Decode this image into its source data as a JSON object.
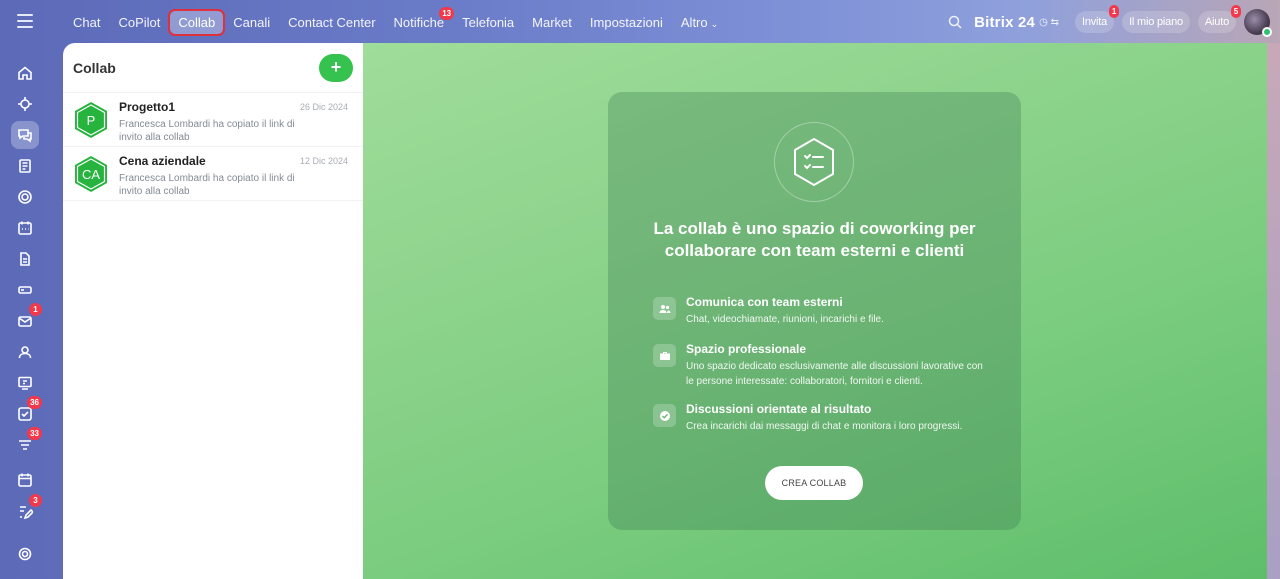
{
  "topnav": {
    "items": [
      {
        "label": "Chat"
      },
      {
        "label": "CoPilot"
      },
      {
        "label": "Collab",
        "active": true
      },
      {
        "label": "Canali"
      },
      {
        "label": "Contact Center"
      },
      {
        "label": "Notifiche",
        "badge": "13"
      },
      {
        "label": "Telefonia"
      },
      {
        "label": "Market"
      },
      {
        "label": "Impostazioni"
      },
      {
        "label": "Altro"
      }
    ],
    "brand": "Bitrix 24",
    "invite_label": "Invita",
    "invite_badge": "1",
    "plan_label": "Il mio piano",
    "help_label": "Aiuto",
    "help_badge": "5"
  },
  "rail": {
    "badges": {
      "mail": "1",
      "tasks": "36",
      "feed": "33",
      "edit": "3"
    }
  },
  "panel": {
    "title": "Collab",
    "items": [
      {
        "initials": "P",
        "name": "Progetto1",
        "date": "26 Dic 2024",
        "message": "Francesca Lombardi ha copiato il link di invito alla collab"
      },
      {
        "initials": "CA",
        "name": "Cena aziendale",
        "date": "12 Dic 2024",
        "message": "Francesca Lombardi ha copiato il link di invito alla collab"
      }
    ]
  },
  "card": {
    "title": "La collab è uno spazio di coworking per collaborare con team esterni e clienti",
    "features": [
      {
        "title": "Comunica con team esterni",
        "desc": "Chat, videochiamate, riunioni, incarichi e file.",
        "icon": "users-icon"
      },
      {
        "title": "Spazio professionale",
        "desc": "Uno spazio dedicato esclusivamente alle discussioni lavorative con le persone interessate: collaboratori, fornitori e clienti.",
        "icon": "briefcase-icon"
      },
      {
        "title": "Discussioni orientate al risultato",
        "desc": "Crea incarichi dai messaggi di chat e monitora i loro progressi.",
        "icon": "check-circle-icon"
      }
    ],
    "cta": "CREA COLLAB"
  },
  "colors": {
    "accent_green": "#35c24f",
    "badge_red": "#f2394b",
    "highlight_outline": "#e0303b"
  }
}
